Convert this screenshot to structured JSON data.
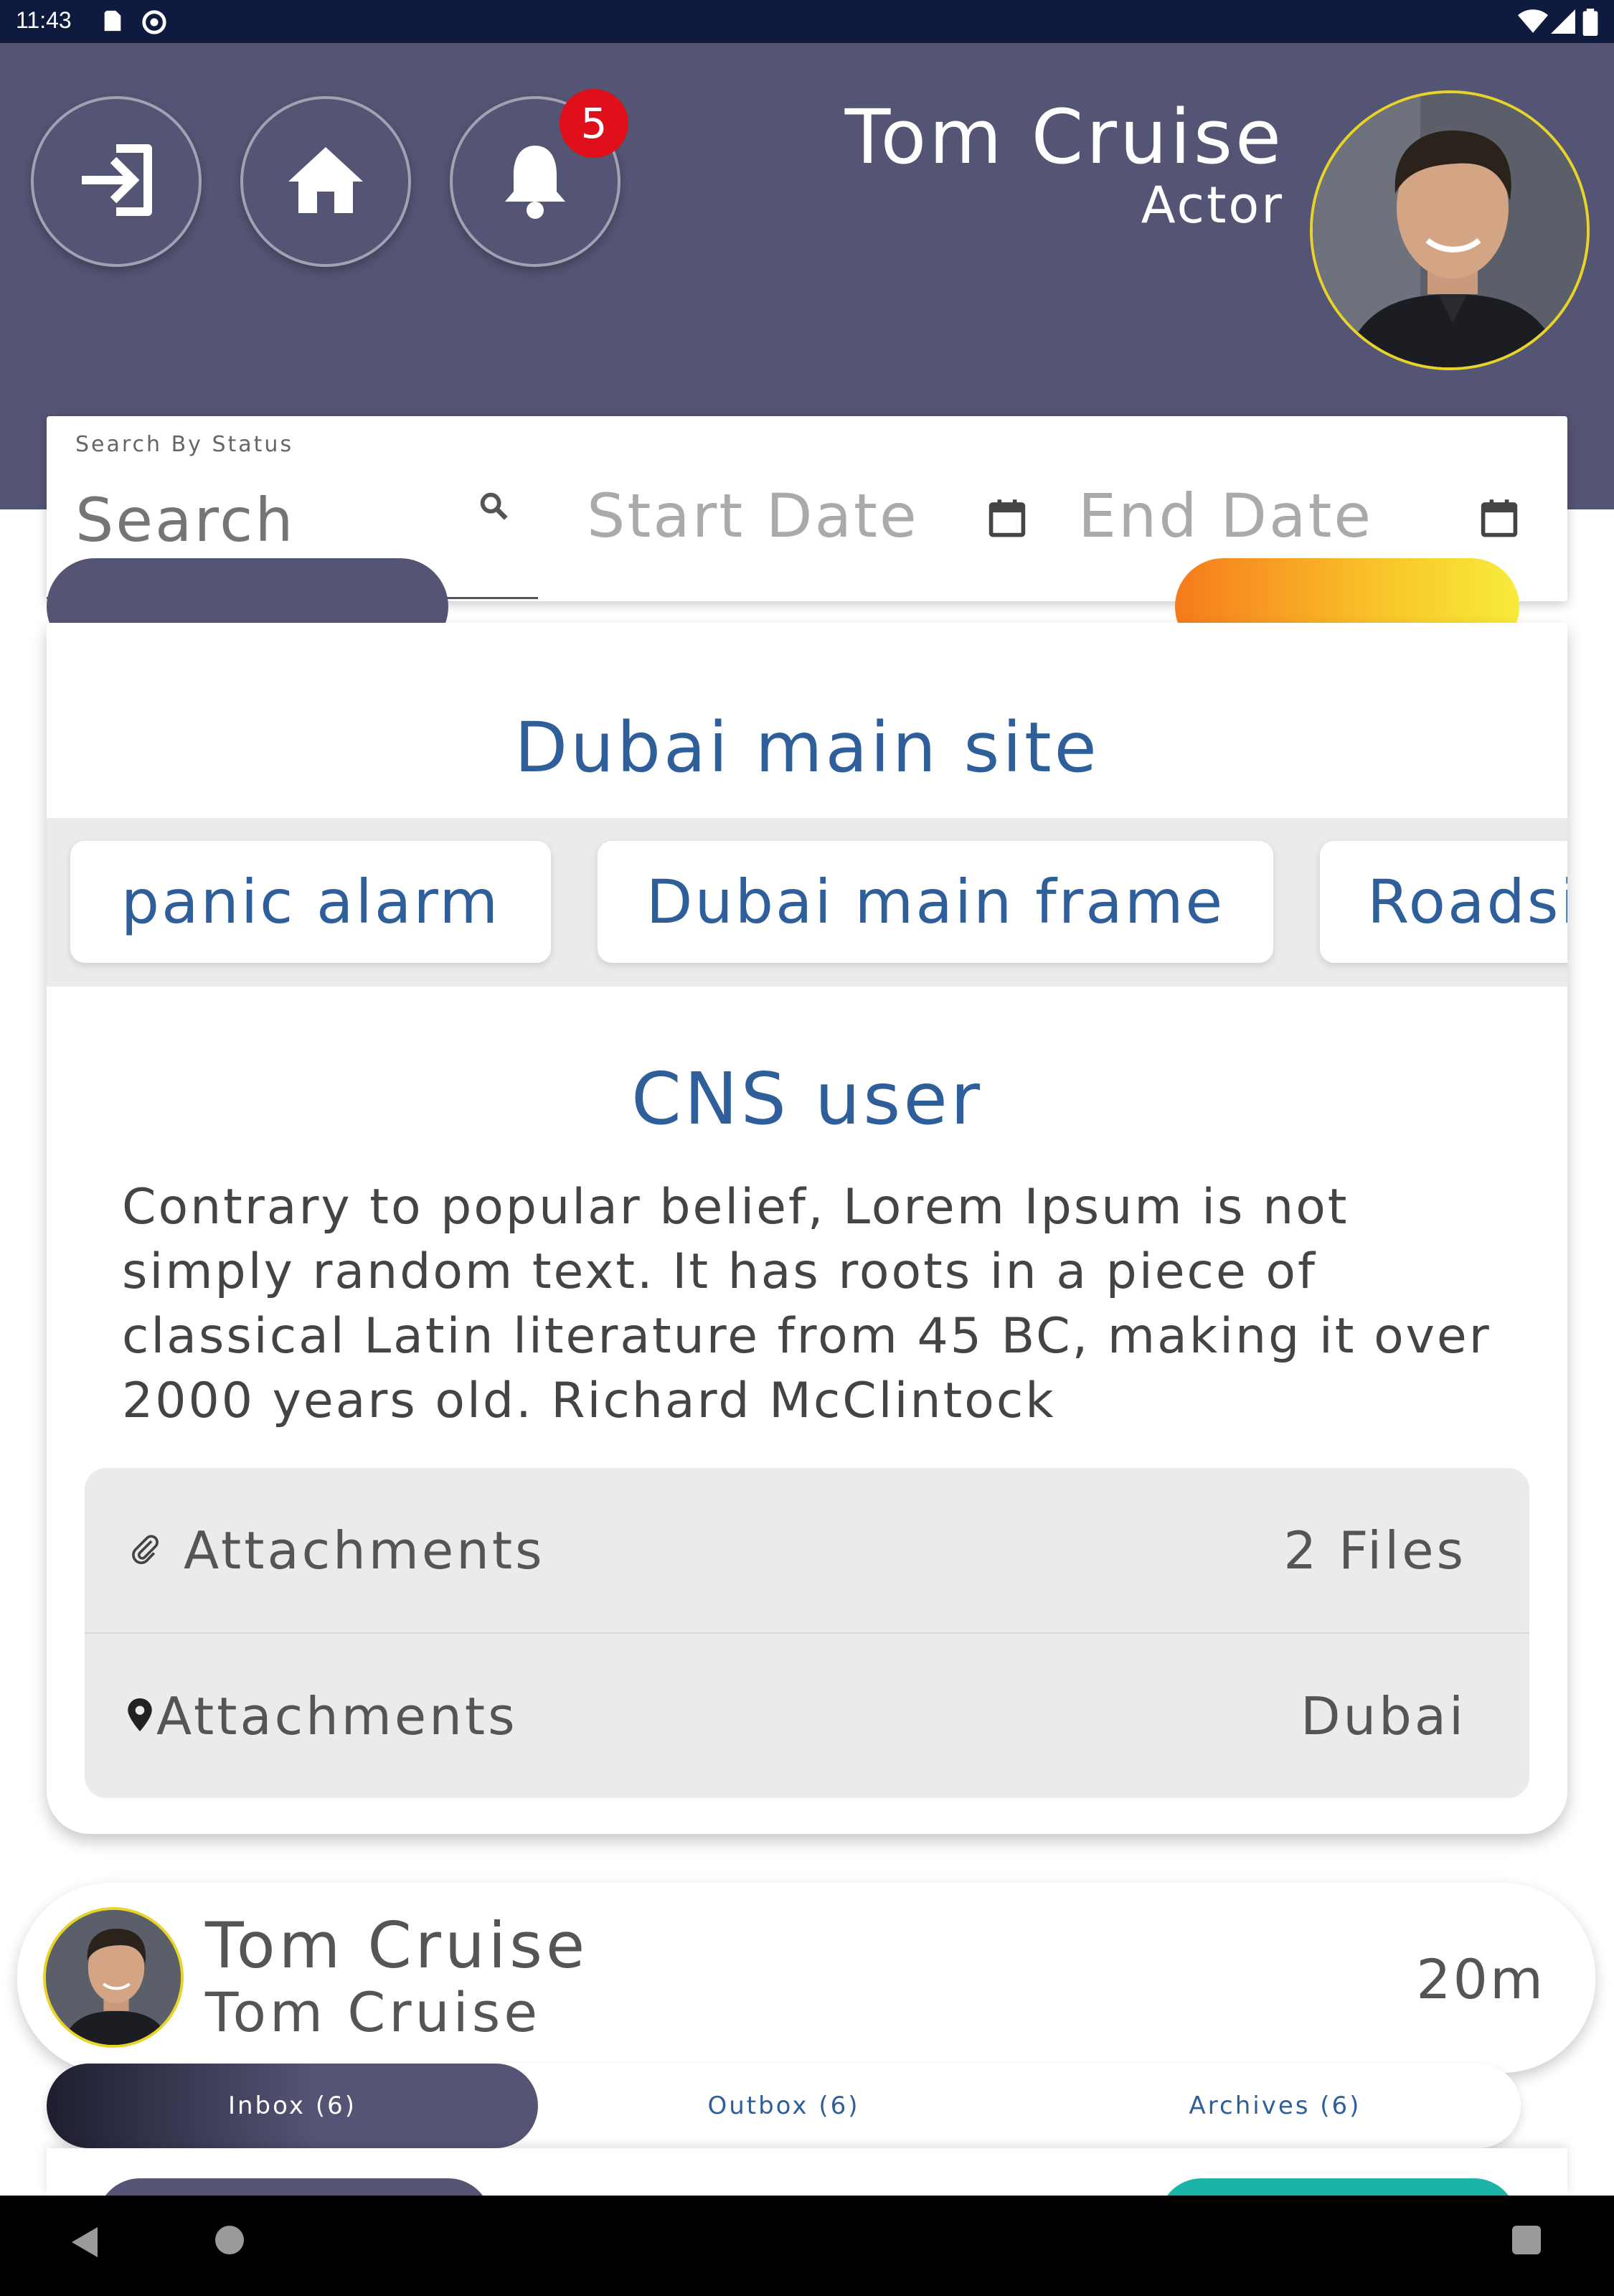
{
  "status_bar": {
    "time": "11:43"
  },
  "header": {
    "login_icon": "login-arrow-icon",
    "home_icon": "home-icon",
    "notifications_icon": "bell-icon",
    "notification_count": "5",
    "user_name": "Tom Cruise",
    "user_role": "Actor"
  },
  "search": {
    "label": "Search By Status",
    "placeholder": "Search",
    "start_date": "Start Date",
    "end_date": "End Date"
  },
  "card": {
    "site_title": "Dubai main site",
    "chips": [
      "panic alarm",
      "Dubai main frame",
      "Roadside"
    ],
    "sender": "CNS user",
    "body": "Contrary to popular belief, Lorem Ipsum is not simply random text. It has roots in a piece of classical Latin literature from 45 BC, making it over 2000 years old. Richard McClintock",
    "attachments_label": "Attachments",
    "attachments_value": "2 Files",
    "location_label": "Attachments",
    "location_value": "Dubai"
  },
  "message": {
    "name": "Tom Cruise",
    "subtitle": "Tom Cruise",
    "time": "20m"
  },
  "tabs": [
    {
      "label": "Inbox (6)",
      "active": true
    },
    {
      "label": "Outbox (6)",
      "active": false
    },
    {
      "label": "Archives (6)",
      "active": false
    }
  ],
  "colors": {
    "header_bg": "#545575",
    "accent_blue": "#2f5f9a",
    "badge_red": "#e0101a",
    "avatar_ring": "#e8d32a"
  }
}
